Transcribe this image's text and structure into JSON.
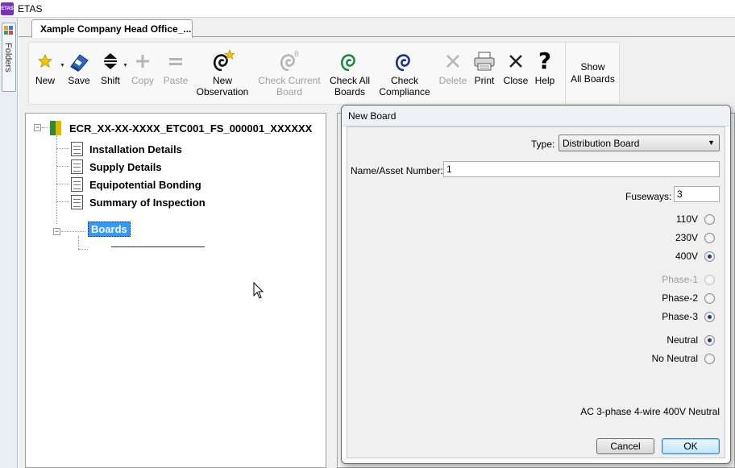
{
  "app": {
    "icon_text": "ETAS",
    "title": "ETAS"
  },
  "folders": {
    "label": "Folders",
    "icon": "folders-icon"
  },
  "document_tab": {
    "label": "Xample Company Head Office_..."
  },
  "toolbar": {
    "new": "New",
    "save": "Save",
    "shift": "Shift",
    "copy": "Copy",
    "paste": "Paste",
    "new_observation_1": "New",
    "new_observation_2": "Observation",
    "check_current_1": "Check Current",
    "check_current_2": "Board",
    "check_all_1": "Check All",
    "check_all_2": "Boards",
    "check_compliance_1": "Check",
    "check_compliance_2": "Compliance",
    "delete": "Delete",
    "print": "Print",
    "close": "Close",
    "help": "Help",
    "show_all_1": "Show",
    "show_all_2": "All Boards"
  },
  "tree": {
    "root": "ECR_XX-XX-XXXX_ETC001_FS_000001_XXXXXX",
    "items": [
      {
        "label": "Installation Details"
      },
      {
        "label": "Supply Details"
      },
      {
        "label": "Equipotential Bonding"
      },
      {
        "label": "Summary of Inspection"
      }
    ],
    "boards": "Boards"
  },
  "dialog": {
    "title": "New Board",
    "type_label": "Type:",
    "type_value": "Distribution Board",
    "name_label": "Name/Asset Number:",
    "name_value": "1",
    "fuseways_label": "Fuseways:",
    "fuseways_value": "3",
    "voltages": [
      {
        "label": "110V",
        "checked": false,
        "disabled": false
      },
      {
        "label": "230V",
        "checked": false,
        "disabled": false
      },
      {
        "label": "400V",
        "checked": true,
        "disabled": false
      }
    ],
    "phases": [
      {
        "label": "Phase-1",
        "checked": false,
        "disabled": true
      },
      {
        "label": "Phase-2",
        "checked": false,
        "disabled": false
      },
      {
        "label": "Phase-3",
        "checked": true,
        "disabled": false
      }
    ],
    "neutral": [
      {
        "label": "Neutral",
        "checked": true,
        "disabled": false
      },
      {
        "label": "No Neutral",
        "checked": false,
        "disabled": false
      }
    ],
    "summary": "AC 3-phase 4-wire 400V Neutral",
    "cancel": "Cancel",
    "ok": "OK"
  },
  "colors": {
    "selection": "#3399ff",
    "app_icon": "#7b2fbe",
    "check_all_green": "#1e8a3a",
    "compliance_blue": "#1d2f8a",
    "star_yellow": "#f5c400"
  }
}
